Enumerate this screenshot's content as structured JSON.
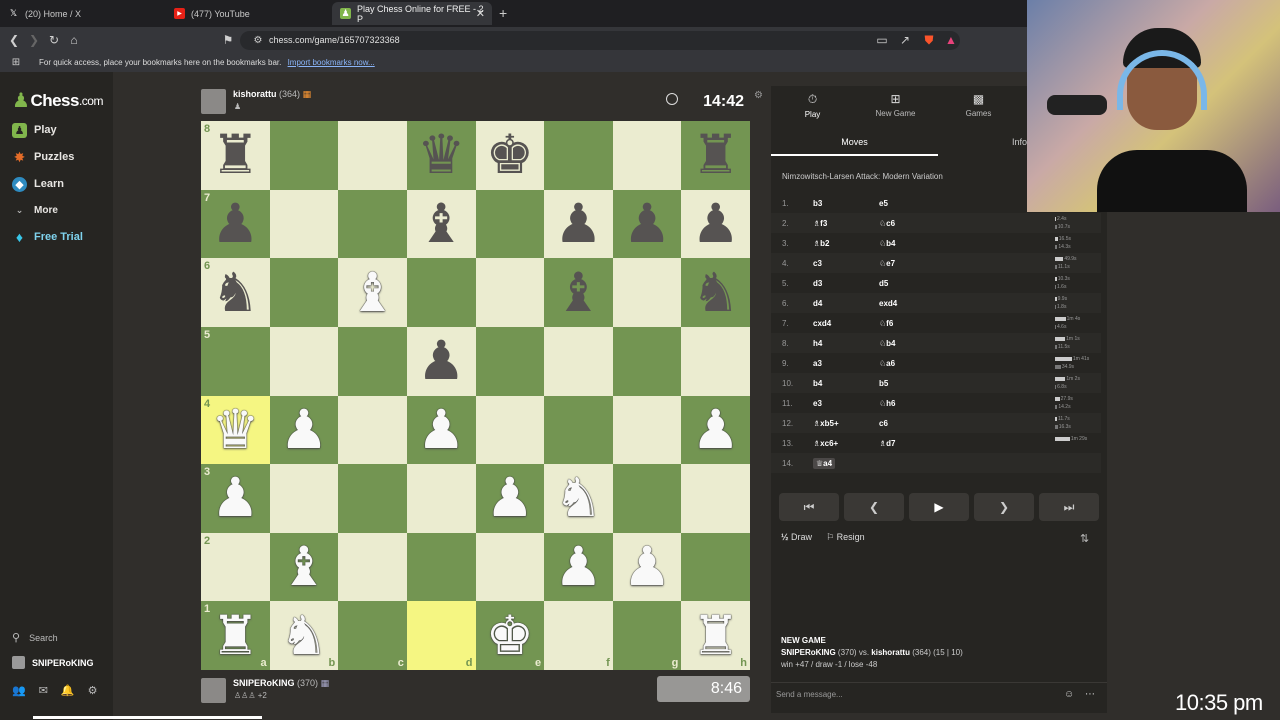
{
  "browser": {
    "tabs": [
      {
        "label": "(20) Home / X",
        "icon": "x-logo-icon"
      },
      {
        "label": "(477) YouTube",
        "icon": "youtube-icon"
      },
      {
        "label": "Play Chess Online for FREE - 2 P",
        "icon": "chess-pawn-icon",
        "active": true
      }
    ],
    "url": "chess.com/game/165707323368",
    "bookmarks_hint": "For quick access, place your bookmarks here on the bookmarks bar.",
    "bookmarks_link": "Import bookmarks now..."
  },
  "sidebar": {
    "logo": "Chess",
    "logo_suffix": ".com",
    "items": [
      {
        "label": "Play",
        "color": "#81b64c"
      },
      {
        "label": "Puzzles",
        "color": "#e46c28"
      },
      {
        "label": "Learn",
        "color": "#2e8bc0"
      },
      {
        "label": "More",
        "color": "#bbbbbb"
      },
      {
        "label": "Free Trial",
        "color": "#38c6e8"
      }
    ],
    "search_label": "Search",
    "username": "SNIPERoKING"
  },
  "top_player": {
    "name": "kishorattu",
    "rating": "(364)",
    "clock": "14:42"
  },
  "bottom_player": {
    "name": "SNIPERoKING",
    "rating": "(370)",
    "extra": "+2",
    "clock": "8:46"
  },
  "board": {
    "ranks": [
      "8",
      "7",
      "6",
      "5",
      "4",
      "3",
      "2",
      "1"
    ],
    "files": [
      "a",
      "b",
      "c",
      "d",
      "e",
      "f",
      "g",
      "h"
    ],
    "rows": [
      [
        "br",
        "",
        "",
        "bq",
        "bk",
        "",
        "",
        "br"
      ],
      [
        "bp",
        "",
        "",
        "bb",
        "",
        "bp",
        "bp",
        "bp"
      ],
      [
        "bn",
        "",
        "wb",
        "",
        "",
        "bb",
        "",
        "bn"
      ],
      [
        "",
        "",
        "",
        "bp",
        "",
        "",
        "",
        ""
      ],
      [
        "wq",
        "wp",
        "",
        "wp",
        "",
        "",
        "",
        "wp"
      ],
      [
        "wp",
        "",
        "",
        "",
        "wp",
        "wn",
        "",
        ""
      ],
      [
        "",
        "wb",
        "",
        "",
        "",
        "wp",
        "wp",
        ""
      ],
      [
        "wr",
        "wn",
        "",
        "",
        "wk",
        "",
        "",
        "wr"
      ]
    ],
    "highlight": [
      "a4",
      "d1"
    ]
  },
  "panel": {
    "tabs": [
      {
        "label": "Play",
        "icon": "stopwatch-icon"
      },
      {
        "label": "New Game",
        "icon": "plus-icon"
      },
      {
        "label": "Games",
        "icon": "games-grid-icon"
      }
    ],
    "subtab_moves": "Moves",
    "subtab_info": "Info",
    "opening": "Nimzowitsch-Larsen Attack: Modern Variation",
    "moves": [
      {
        "n": "1.",
        "w": "b3",
        "b": "e5",
        "tw": "1.6s",
        "tb": "5.8s"
      },
      {
        "n": "2.",
        "w": "♗f3",
        "b": "♘c6",
        "tw": "2.4s",
        "tb": "10.7s"
      },
      {
        "n": "3.",
        "w": "♗b2",
        "b": "♘b4",
        "tw": "16.5s",
        "tb": "14.3s"
      },
      {
        "n": "4.",
        "w": "c3",
        "b": "♘e7",
        "tw": "49.9s",
        "tb": "11.1s"
      },
      {
        "n": "5.",
        "w": "d3",
        "b": "d5",
        "tw": "10.3s",
        "tb": "1.6s"
      },
      {
        "n": "6.",
        "w": "d4",
        "b": "exd4",
        "tw": "9.9s",
        "tb": "1.8s"
      },
      {
        "n": "7.",
        "w": "cxd4",
        "b": "♘f6",
        "tw": "1m 4s",
        "tb": "4.6s"
      },
      {
        "n": "8.",
        "w": "h4",
        "b": "♘b4",
        "tw": "1m 1s",
        "tb": "11.5s"
      },
      {
        "n": "9.",
        "w": "a3",
        "b": "♘a6",
        "tw": "1m 41s",
        "tb": "34.9s"
      },
      {
        "n": "10.",
        "w": "b4",
        "b": "b5",
        "tw": "1m 2s",
        "tb": "6.8s"
      },
      {
        "n": "11.",
        "w": "e3",
        "b": "♘h6",
        "tw": "27.9s",
        "tb": "14.2s"
      },
      {
        "n": "12.",
        "w": "♗xb5+",
        "b": "c6",
        "tw": "11.7s",
        "tb": "16.3s"
      },
      {
        "n": "13.",
        "w": "♗xc6+",
        "b": "♗d7",
        "tw": "1m 29s",
        "tb": ""
      },
      {
        "n": "14.",
        "w": "♕a4",
        "b": "",
        "tw": "",
        "tb": ""
      }
    ],
    "draw_label": "Draw",
    "resign_label": "Resign",
    "new_game_title": "NEW GAME",
    "new_game_white": "SNIPERoKING",
    "new_game_white_rating": "(370)",
    "new_game_vs": "vs.",
    "new_game_black": "kishorattu",
    "new_game_black_rating": "(364) (15 | 10)",
    "new_game_stats": "win +47 / draw -1 / lose -48",
    "message_placeholder": "Send a message..."
  },
  "overlay_clock": "10:35 pm"
}
